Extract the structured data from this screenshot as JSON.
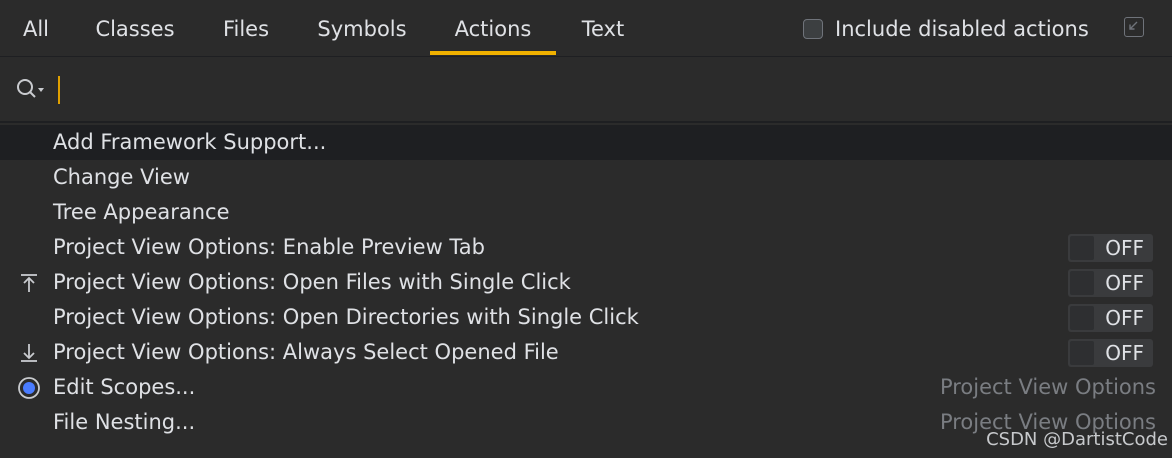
{
  "tabs": [
    {
      "label": "All",
      "active": false
    },
    {
      "label": "Classes",
      "active": false
    },
    {
      "label": "Files",
      "active": false
    },
    {
      "label": "Symbols",
      "active": false
    },
    {
      "label": "Actions",
      "active": true
    },
    {
      "label": "Text",
      "active": false
    }
  ],
  "option": {
    "label": "Include disabled actions",
    "checked": false
  },
  "search": {
    "value": ""
  },
  "results": [
    {
      "label": "Add Framework Support...",
      "selected": true
    },
    {
      "label": "Change View"
    },
    {
      "label": "Tree Appearance"
    },
    {
      "label": "Project View Options: Enable Preview Tab",
      "toggle": "OFF"
    },
    {
      "label": "Project View Options: Open Files with Single Click",
      "toggle": "OFF",
      "icon": "upload-arrow-icon"
    },
    {
      "label": "Project View Options: Open Directories with Single Click",
      "toggle": "OFF"
    },
    {
      "label": "Project View Options: Always Select Opened File",
      "toggle": "OFF",
      "icon": "download-arrow-icon"
    },
    {
      "label": "Edit Scopes...",
      "hint": "Project View Options",
      "icon": "scope-radio-icon"
    },
    {
      "label": "File Nesting...",
      "hint": "Project View Options"
    }
  ],
  "watermark": "CSDN @DartistCode",
  "colors": {
    "accent": "#f0b100",
    "background": "#2b2b2b",
    "selected_row": "#1e1f22"
  }
}
